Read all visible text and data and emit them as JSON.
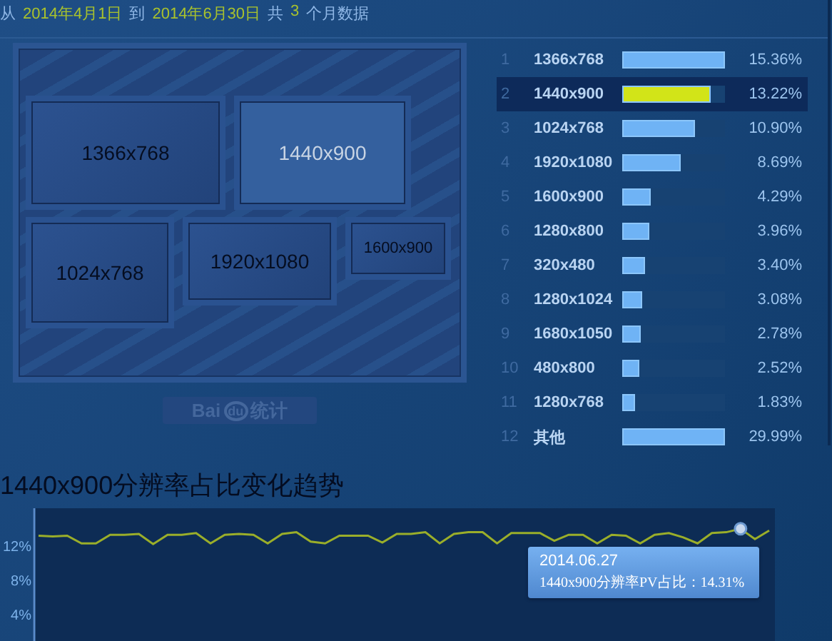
{
  "header": [
    {
      "kind": "label",
      "text": "从"
    },
    {
      "kind": "value",
      "text": "2014年4月1日"
    },
    {
      "kind": "label",
      "text": "到"
    },
    {
      "kind": "value",
      "text": "2014年6月30日"
    },
    {
      "kind": "label",
      "text": "共"
    },
    {
      "kind": "value",
      "text": "3"
    },
    {
      "kind": "label",
      "text": "个月数据"
    }
  ],
  "monitor": {
    "screens": [
      {
        "label": "1366x768",
        "selected": false
      },
      {
        "label": "1440x900",
        "selected": true
      },
      {
        "label": "1024x768",
        "selected": false
      },
      {
        "label": "1920x1080",
        "selected": false
      },
      {
        "label": "1600x900",
        "selected": false
      }
    ],
    "logo": {
      "left": "Bai",
      "mark": "du",
      "right": "统计"
    }
  },
  "ranking": [
    {
      "rank": "1",
      "name": "1366x768",
      "level": 1.0,
      "value": "15.36%",
      "selected": false
    },
    {
      "rank": "2",
      "name": "1440x900",
      "level": 0.86,
      "value": "13.22%",
      "selected": true
    },
    {
      "rank": "3",
      "name": "1024x768",
      "level": 0.71,
      "value": "10.90%",
      "selected": false
    },
    {
      "rank": "4",
      "name": "1920x1080",
      "level": 0.57,
      "value": "8.69%",
      "selected": false
    },
    {
      "rank": "5",
      "name": "1600x900",
      "level": 0.28,
      "value": "4.29%",
      "selected": false
    },
    {
      "rank": "6",
      "name": "1280x800",
      "level": 0.26,
      "value": "3.96%",
      "selected": false
    },
    {
      "rank": "7",
      "name": "320x480",
      "level": 0.22,
      "value": "3.40%",
      "selected": false
    },
    {
      "rank": "8",
      "name": "1280x1024",
      "level": 0.2,
      "value": "3.08%",
      "selected": false
    },
    {
      "rank": "9",
      "name": "1680x1050",
      "level": 0.18,
      "value": "2.78%",
      "selected": false
    },
    {
      "rank": "10",
      "name": "480x800",
      "level": 0.16,
      "value": "2.52%",
      "selected": false
    },
    {
      "rank": "11",
      "name": "1280x768",
      "level": 0.12,
      "value": "1.83%",
      "selected": false
    },
    {
      "rank": "12",
      "name": "其他",
      "level": 1.0,
      "value": "29.99%",
      "selected": false
    }
  ],
  "trend": {
    "title": "1440x900分辨率占比变化趋势",
    "chart_data": {
      "type": "line",
      "ylim": [
        0,
        16.7
      ],
      "yticks": [
        {
          "value": 4,
          "label": "4%"
        },
        {
          "value": 8,
          "label": "8%"
        },
        {
          "value": 12,
          "label": "12%"
        }
      ],
      "series": [
        {
          "color": "#9aae2a",
          "values": [
            13.5,
            13.4,
            13.5,
            12.6,
            12.6,
            13.6,
            13.6,
            13.7,
            12.5,
            13.6,
            13.6,
            13.8,
            12.6,
            13.6,
            13.7,
            13.6,
            12.6,
            13.7,
            13.9,
            12.8,
            12.6,
            13.5,
            13.5,
            13.5,
            12.7,
            13.7,
            13.7,
            13.9,
            12.6,
            13.7,
            13.9,
            13.9,
            12.6,
            13.8,
            13.8,
            13.8,
            12.9,
            13.6,
            13.6,
            12.6,
            13.6,
            13.5,
            12.6,
            13.6,
            13.8,
            13.3,
            12.6,
            13.8,
            13.9,
            14.3,
            13.1,
            14.1
          ]
        }
      ]
    },
    "tooltip": {
      "date": "2014.06.27",
      "text": "1440x900分辨率PV占比：14.31%"
    }
  }
}
